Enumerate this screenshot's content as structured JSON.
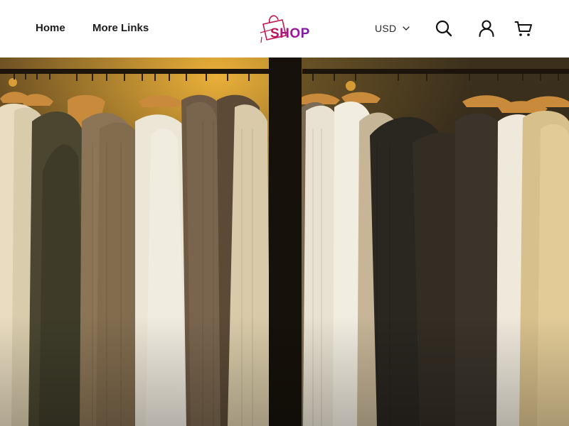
{
  "nav": {
    "home_label": "Home",
    "more_links_label": "More Links"
  },
  "logo": {
    "text": "SHOP",
    "icon": "shopping-bag-icon"
  },
  "currency": {
    "selected": "USD",
    "icon": "chevron-down-icon"
  },
  "actions": {
    "search_icon": "search-icon",
    "account_icon": "user-icon",
    "cart_icon": "cart-icon"
  },
  "hero": {
    "image": "clothing-rack-photo"
  },
  "colors": {
    "header_bg": "#ffffff",
    "text": "#1c1c1c",
    "logo_pink": "#c0144e",
    "logo_purple": "#a3139a"
  }
}
